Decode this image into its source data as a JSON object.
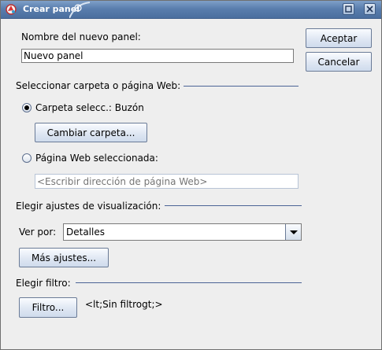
{
  "window": {
    "title": "Crear panel"
  },
  "form": {
    "name_label": "Nombre del nuevo panel:",
    "name_value": "Nuevo panel",
    "folder_section_label": "Seleccionar carpeta o página Web:",
    "folder_radio_label": "Carpeta selecc.: Buzón",
    "change_folder_button": "Cambiar carpeta...",
    "web_radio_label": "Página Web seleccionada:",
    "web_placeholder": "<Escribir dirección de página Web>",
    "view_section_label": "Elegir ajustes de visualización:",
    "view_by_label": "Ver por:",
    "view_by_value": "Detalles",
    "more_settings_button": "Más ajustes...",
    "filter_section_label": "Elegir filtro:",
    "filter_button": "Filtro...",
    "filter_value": "<lt;Sin filtrogt;>"
  },
  "actions": {
    "accept_label": "Aceptar",
    "cancel_label": "Cancelar"
  }
}
